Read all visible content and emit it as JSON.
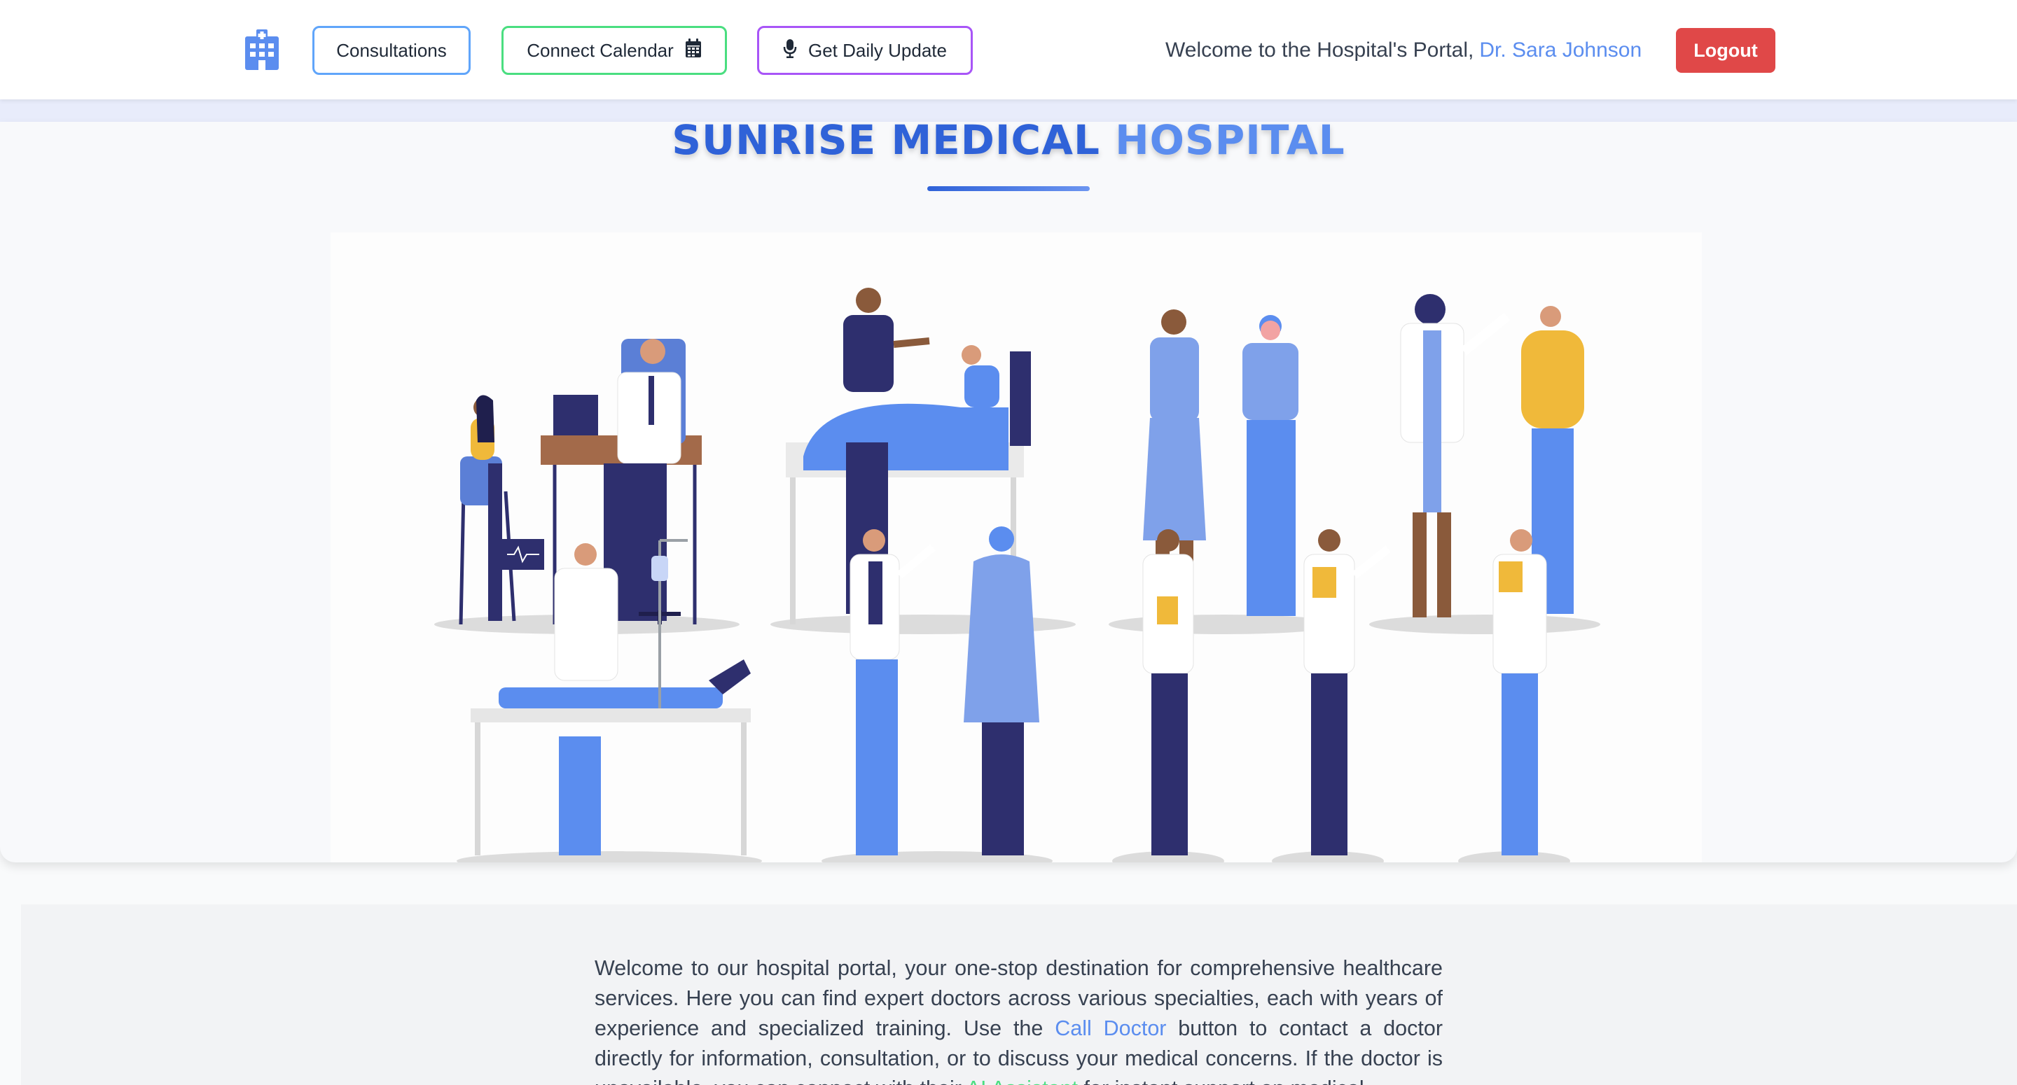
{
  "header": {
    "logo_icon": "hospital-building-icon",
    "nav": {
      "consultations": "Consultations",
      "connect_calendar": "Connect Calendar",
      "calendar_icon": "calendar-icon",
      "daily_update": "Get Daily Update",
      "mic_icon": "microphone-icon"
    },
    "welcome_prefix": "Welcome to the Hospital's Portal,",
    "doctor_name": "Dr. Sara Johnson",
    "logout": "Logout"
  },
  "hero": {
    "title_part1": "SUNRISE MEDICAL",
    "title_part2": "HOSPITAL",
    "illustration": "medical-staff-illustration"
  },
  "intro": {
    "p1": "Welcome to our hospital portal, your one-stop destination for comprehensive healthcare services. Here you can find expert doctors across various specialties, each with years of experience and specialized training. Use the",
    "call_doctor": "Call Doctor",
    "p2": "button to contact a doctor directly for information, consultation, or to discuss your medical concerns. If the doctor is unavailable, you can connect with their",
    "ai_assistant": "AI Assistant",
    "p3": "for instant support on medical"
  },
  "colors": {
    "consult_border": "#60a5fa",
    "calendar_border": "#4ade80",
    "update_border": "#a855f7",
    "logout_bg": "#e04848",
    "doctor_name": "#5b8def",
    "title_dark": "#2f62d8",
    "title_light": "#5b8def"
  }
}
